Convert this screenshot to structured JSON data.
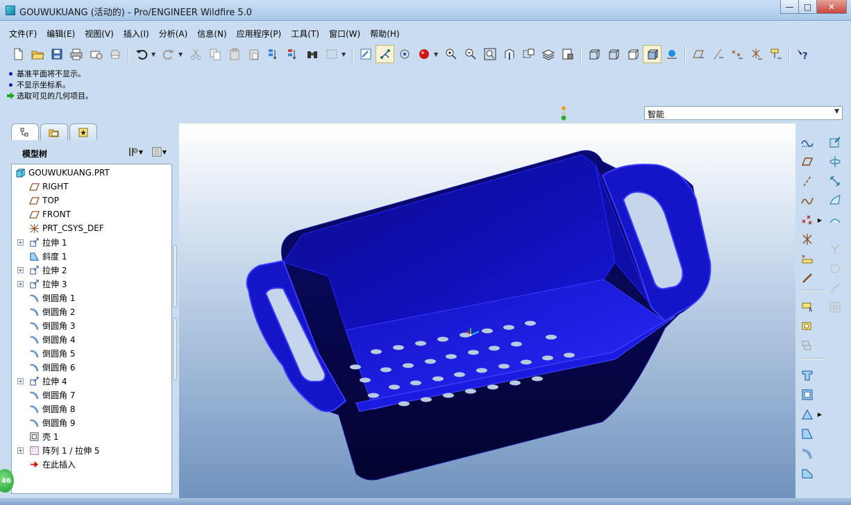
{
  "window": {
    "title": "GOUWUKUANG (活动的) - Pro/ENGINEER Wildfire 5.0",
    "buttons": {
      "minimize": "—",
      "maximize": "□",
      "close": "✕"
    }
  },
  "menu": [
    "文件(F)",
    "编辑(E)",
    "视图(V)",
    "插入(I)",
    "分析(A)",
    "信息(N)",
    "应用程序(P)",
    "工具(T)",
    "窗口(W)",
    "帮助(H)"
  ],
  "messages": [
    {
      "type": "info",
      "text": "基准平面将不显示。"
    },
    {
      "type": "info",
      "text": "不显示坐标系。"
    },
    {
      "type": "prompt",
      "text": "选取可见的几何项目。"
    }
  ],
  "selection_filter": {
    "value": "智能"
  },
  "model_tree": {
    "title": "模型树",
    "items": [
      {
        "label": "GOUWUKUANG.PRT",
        "icon": "part-icon",
        "expandable": false
      },
      {
        "label": "RIGHT",
        "icon": "datum-plane-icon",
        "expandable": false
      },
      {
        "label": "TOP",
        "icon": "datum-plane-icon",
        "expandable": false
      },
      {
        "label": "FRONT",
        "icon": "datum-plane-icon",
        "expandable": false
      },
      {
        "label": "PRT_CSYS_DEF",
        "icon": "csys-icon",
        "expandable": false
      },
      {
        "label": "拉伸 1",
        "icon": "extrude-icon",
        "expandable": true
      },
      {
        "label": "斜度 1",
        "icon": "draft-icon",
        "expandable": false
      },
      {
        "label": "拉伸 2",
        "icon": "extrude-icon",
        "expandable": true
      },
      {
        "label": "拉伸 3",
        "icon": "extrude-icon",
        "expandable": true
      },
      {
        "label": "倒圆角 1",
        "icon": "round-icon",
        "expandable": false
      },
      {
        "label": "倒圆角 2",
        "icon": "round-icon",
        "expandable": false
      },
      {
        "label": "倒圆角 3",
        "icon": "round-icon",
        "expandable": false
      },
      {
        "label": "倒圆角 4",
        "icon": "round-icon",
        "expandable": false
      },
      {
        "label": "倒圆角 5",
        "icon": "round-icon",
        "expandable": false
      },
      {
        "label": "倒圆角 6",
        "icon": "round-icon",
        "expandable": false
      },
      {
        "label": "拉伸 4",
        "icon": "extrude-icon",
        "expandable": true
      },
      {
        "label": "倒圆角 7",
        "icon": "round-icon",
        "expandable": false
      },
      {
        "label": "倒圆角 8",
        "icon": "round-icon",
        "expandable": false
      },
      {
        "label": "倒圆角 9",
        "icon": "round-icon",
        "expandable": false
      },
      {
        "label": "壳 1",
        "icon": "shell-icon",
        "expandable": false
      },
      {
        "label": "阵列 1 / 拉伸 5",
        "icon": "pattern-icon",
        "expandable": true
      },
      {
        "label": "在此插入",
        "icon": "insert-here-icon",
        "expandable": false
      }
    ]
  },
  "badge": "46",
  "colors": {
    "model_face": "#1010b0",
    "model_edge": "#3a3aff",
    "model_dark": "#06064a",
    "accent": "#1a1aa8"
  }
}
